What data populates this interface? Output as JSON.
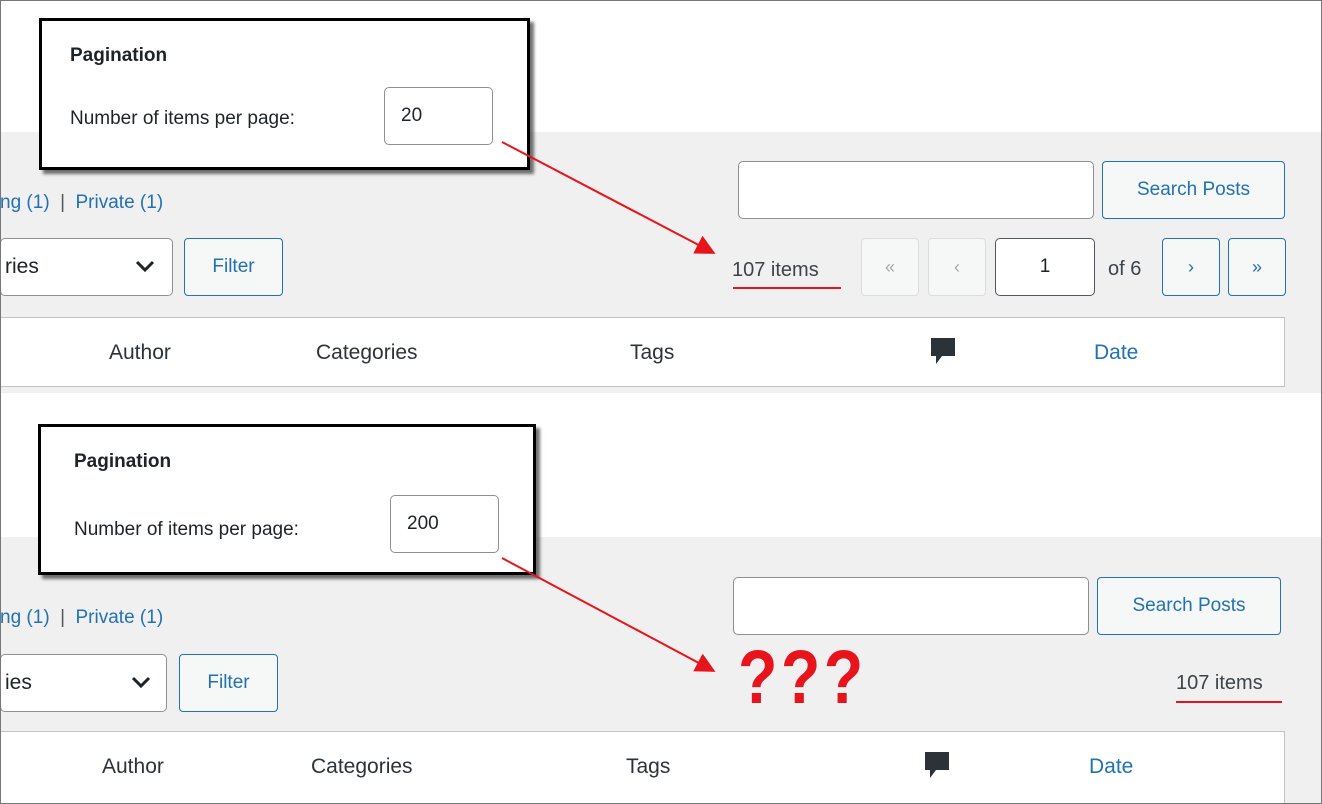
{
  "top": {
    "callout": {
      "title": "Pagination",
      "label": "Number of items per page:",
      "value": "20"
    },
    "status_links": [
      {
        "label": "ng",
        "count": "(1)"
      },
      {
        "label": "Private",
        "count": "(1)"
      }
    ],
    "separator": "|",
    "category_select": "ries",
    "filter_button": "Filter",
    "search_button": "Search Posts",
    "items_count": "107 items",
    "pagination": {
      "first": "«",
      "prev": "‹",
      "current_page": "1",
      "of_text": "of 6",
      "next": "›",
      "last": "»"
    },
    "columns": {
      "author": "Author",
      "categories": "Categories",
      "tags": "Tags",
      "comments_icon": "comment-icon",
      "date": "Date"
    }
  },
  "bottom": {
    "callout": {
      "title": "Pagination",
      "label": "Number of items per page:",
      "value": "200"
    },
    "status_links": [
      {
        "label": "ng",
        "count": "(1)"
      },
      {
        "label": "Private",
        "count": "(1)"
      }
    ],
    "separator": "|",
    "category_select": "ies",
    "filter_button": "Filter",
    "search_button": "Search Posts",
    "items_count": "107 items",
    "question_marks": "???",
    "columns": {
      "author": "Author",
      "categories": "Categories",
      "tags": "Tags",
      "comments_icon": "comment-icon",
      "date": "Date"
    }
  },
  "colors": {
    "link": "#2271b1",
    "annotation_red": "#e8141b",
    "admin_gray": "#f0f0f1"
  }
}
